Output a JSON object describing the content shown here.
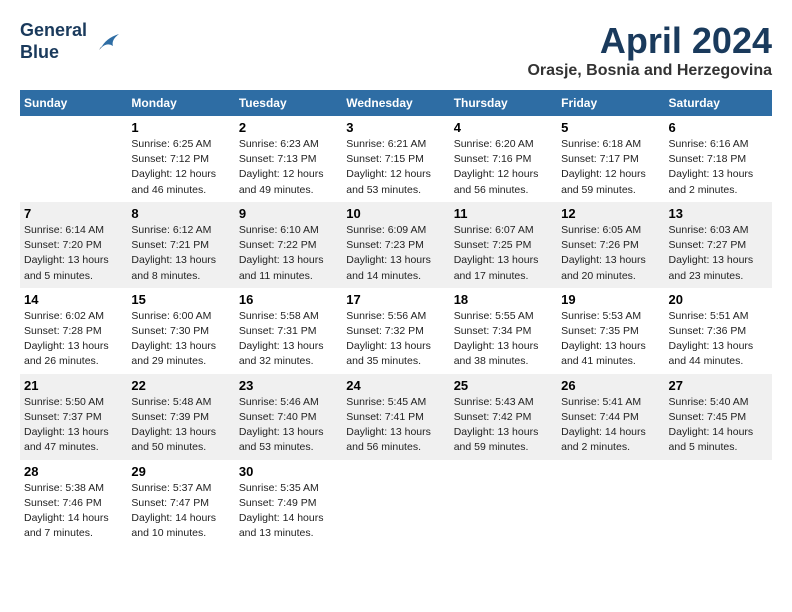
{
  "header": {
    "logo_line1": "General",
    "logo_line2": "Blue",
    "title": "April 2024",
    "subtitle": "Orasje, Bosnia and Herzegovina"
  },
  "days_of_week": [
    "Sunday",
    "Monday",
    "Tuesday",
    "Wednesday",
    "Thursday",
    "Friday",
    "Saturday"
  ],
  "weeks": [
    [
      {
        "num": "",
        "info": ""
      },
      {
        "num": "1",
        "info": "Sunrise: 6:25 AM\nSunset: 7:12 PM\nDaylight: 12 hours\nand 46 minutes."
      },
      {
        "num": "2",
        "info": "Sunrise: 6:23 AM\nSunset: 7:13 PM\nDaylight: 12 hours\nand 49 minutes."
      },
      {
        "num": "3",
        "info": "Sunrise: 6:21 AM\nSunset: 7:15 PM\nDaylight: 12 hours\nand 53 minutes."
      },
      {
        "num": "4",
        "info": "Sunrise: 6:20 AM\nSunset: 7:16 PM\nDaylight: 12 hours\nand 56 minutes."
      },
      {
        "num": "5",
        "info": "Sunrise: 6:18 AM\nSunset: 7:17 PM\nDaylight: 12 hours\nand 59 minutes."
      },
      {
        "num": "6",
        "info": "Sunrise: 6:16 AM\nSunset: 7:18 PM\nDaylight: 13 hours\nand 2 minutes."
      }
    ],
    [
      {
        "num": "7",
        "info": "Sunrise: 6:14 AM\nSunset: 7:20 PM\nDaylight: 13 hours\nand 5 minutes."
      },
      {
        "num": "8",
        "info": "Sunrise: 6:12 AM\nSunset: 7:21 PM\nDaylight: 13 hours\nand 8 minutes."
      },
      {
        "num": "9",
        "info": "Sunrise: 6:10 AM\nSunset: 7:22 PM\nDaylight: 13 hours\nand 11 minutes."
      },
      {
        "num": "10",
        "info": "Sunrise: 6:09 AM\nSunset: 7:23 PM\nDaylight: 13 hours\nand 14 minutes."
      },
      {
        "num": "11",
        "info": "Sunrise: 6:07 AM\nSunset: 7:25 PM\nDaylight: 13 hours\nand 17 minutes."
      },
      {
        "num": "12",
        "info": "Sunrise: 6:05 AM\nSunset: 7:26 PM\nDaylight: 13 hours\nand 20 minutes."
      },
      {
        "num": "13",
        "info": "Sunrise: 6:03 AM\nSunset: 7:27 PM\nDaylight: 13 hours\nand 23 minutes."
      }
    ],
    [
      {
        "num": "14",
        "info": "Sunrise: 6:02 AM\nSunset: 7:28 PM\nDaylight: 13 hours\nand 26 minutes."
      },
      {
        "num": "15",
        "info": "Sunrise: 6:00 AM\nSunset: 7:30 PM\nDaylight: 13 hours\nand 29 minutes."
      },
      {
        "num": "16",
        "info": "Sunrise: 5:58 AM\nSunset: 7:31 PM\nDaylight: 13 hours\nand 32 minutes."
      },
      {
        "num": "17",
        "info": "Sunrise: 5:56 AM\nSunset: 7:32 PM\nDaylight: 13 hours\nand 35 minutes."
      },
      {
        "num": "18",
        "info": "Sunrise: 5:55 AM\nSunset: 7:34 PM\nDaylight: 13 hours\nand 38 minutes."
      },
      {
        "num": "19",
        "info": "Sunrise: 5:53 AM\nSunset: 7:35 PM\nDaylight: 13 hours\nand 41 minutes."
      },
      {
        "num": "20",
        "info": "Sunrise: 5:51 AM\nSunset: 7:36 PM\nDaylight: 13 hours\nand 44 minutes."
      }
    ],
    [
      {
        "num": "21",
        "info": "Sunrise: 5:50 AM\nSunset: 7:37 PM\nDaylight: 13 hours\nand 47 minutes."
      },
      {
        "num": "22",
        "info": "Sunrise: 5:48 AM\nSunset: 7:39 PM\nDaylight: 13 hours\nand 50 minutes."
      },
      {
        "num": "23",
        "info": "Sunrise: 5:46 AM\nSunset: 7:40 PM\nDaylight: 13 hours\nand 53 minutes."
      },
      {
        "num": "24",
        "info": "Sunrise: 5:45 AM\nSunset: 7:41 PM\nDaylight: 13 hours\nand 56 minutes."
      },
      {
        "num": "25",
        "info": "Sunrise: 5:43 AM\nSunset: 7:42 PM\nDaylight: 13 hours\nand 59 minutes."
      },
      {
        "num": "26",
        "info": "Sunrise: 5:41 AM\nSunset: 7:44 PM\nDaylight: 14 hours\nand 2 minutes."
      },
      {
        "num": "27",
        "info": "Sunrise: 5:40 AM\nSunset: 7:45 PM\nDaylight: 14 hours\nand 5 minutes."
      }
    ],
    [
      {
        "num": "28",
        "info": "Sunrise: 5:38 AM\nSunset: 7:46 PM\nDaylight: 14 hours\nand 7 minutes."
      },
      {
        "num": "29",
        "info": "Sunrise: 5:37 AM\nSunset: 7:47 PM\nDaylight: 14 hours\nand 10 minutes."
      },
      {
        "num": "30",
        "info": "Sunrise: 5:35 AM\nSunset: 7:49 PM\nDaylight: 14 hours\nand 13 minutes."
      },
      {
        "num": "",
        "info": ""
      },
      {
        "num": "",
        "info": ""
      },
      {
        "num": "",
        "info": ""
      },
      {
        "num": "",
        "info": ""
      }
    ]
  ]
}
